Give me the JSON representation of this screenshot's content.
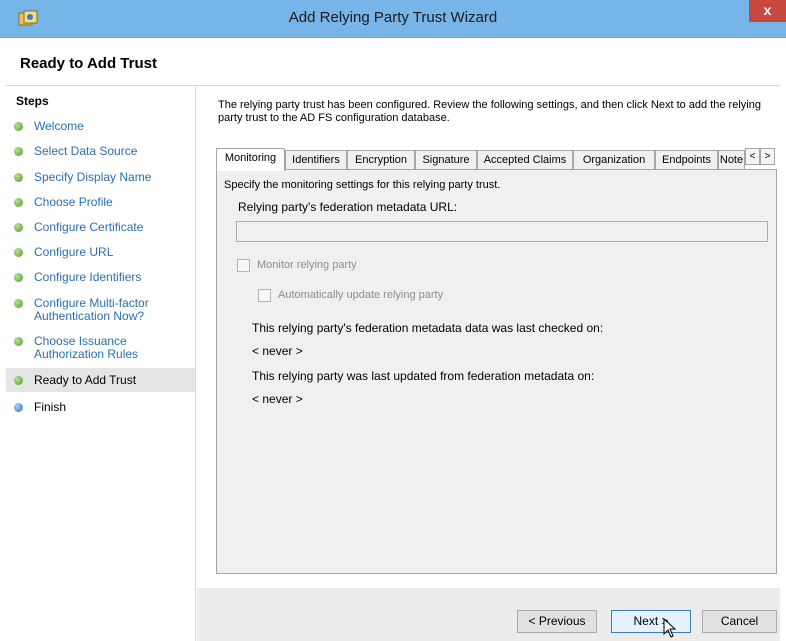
{
  "window": {
    "title": "Add Relying Party Trust Wizard",
    "close_glyph": "x",
    "icon": "adfs-trust-icon"
  },
  "header": {
    "title": "Ready to Add Trust"
  },
  "sidebar": {
    "heading": "Steps",
    "steps": [
      {
        "label": "Welcome",
        "status": "complete"
      },
      {
        "label": "Select Data Source",
        "status": "complete"
      },
      {
        "label": "Specify Display Name",
        "status": "complete"
      },
      {
        "label": "Choose Profile",
        "status": "complete"
      },
      {
        "label": "Configure Certificate",
        "status": "complete"
      },
      {
        "label": "Configure URL",
        "status": "complete"
      },
      {
        "label": "Configure Identifiers",
        "status": "complete"
      },
      {
        "label": "Configure Multi-factor Authentication Now?",
        "status": "complete"
      },
      {
        "label": "Choose Issuance Authorization Rules",
        "status": "complete"
      },
      {
        "label": "Ready to Add Trust",
        "status": "current"
      },
      {
        "label": "Finish",
        "status": "pending"
      }
    ]
  },
  "main": {
    "intro": "The relying party trust has been configured. Review the following settings, and then click Next to add the relying party trust to the AD FS configuration database.",
    "tabs": [
      {
        "label": "Monitoring",
        "active": true
      },
      {
        "label": "Identifiers"
      },
      {
        "label": "Encryption"
      },
      {
        "label": "Signature"
      },
      {
        "label": "Accepted Claims"
      },
      {
        "label": "Organization"
      },
      {
        "label": "Endpoints"
      },
      {
        "label": "Note"
      }
    ],
    "tab_scroll": {
      "left": "<",
      "right": ">"
    },
    "monitoring": {
      "description": "Specify the monitoring settings for this relying party trust.",
      "url_label": "Relying party's federation metadata URL:",
      "url_value": "",
      "monitor_checkbox_label": "Monitor relying party",
      "auto_update_checkbox_label": "Automatically update relying party",
      "last_checked_label": "This relying party's federation metadata data was last checked on:",
      "last_checked_value": "< never >",
      "last_updated_label": "This relying party was last updated from federation metadata on:",
      "last_updated_value": "< never >"
    }
  },
  "footer": {
    "previous_label": "< Previous",
    "next_label": "Next >",
    "cancel_label": "Cancel"
  },
  "colors": {
    "titlebar": "#77b5e8",
    "close_button": "#c7483c",
    "step_link": "#2b6fb0",
    "step_complete_dot": "#4c9a2a",
    "step_pending_dot": "#2d6fc4"
  }
}
